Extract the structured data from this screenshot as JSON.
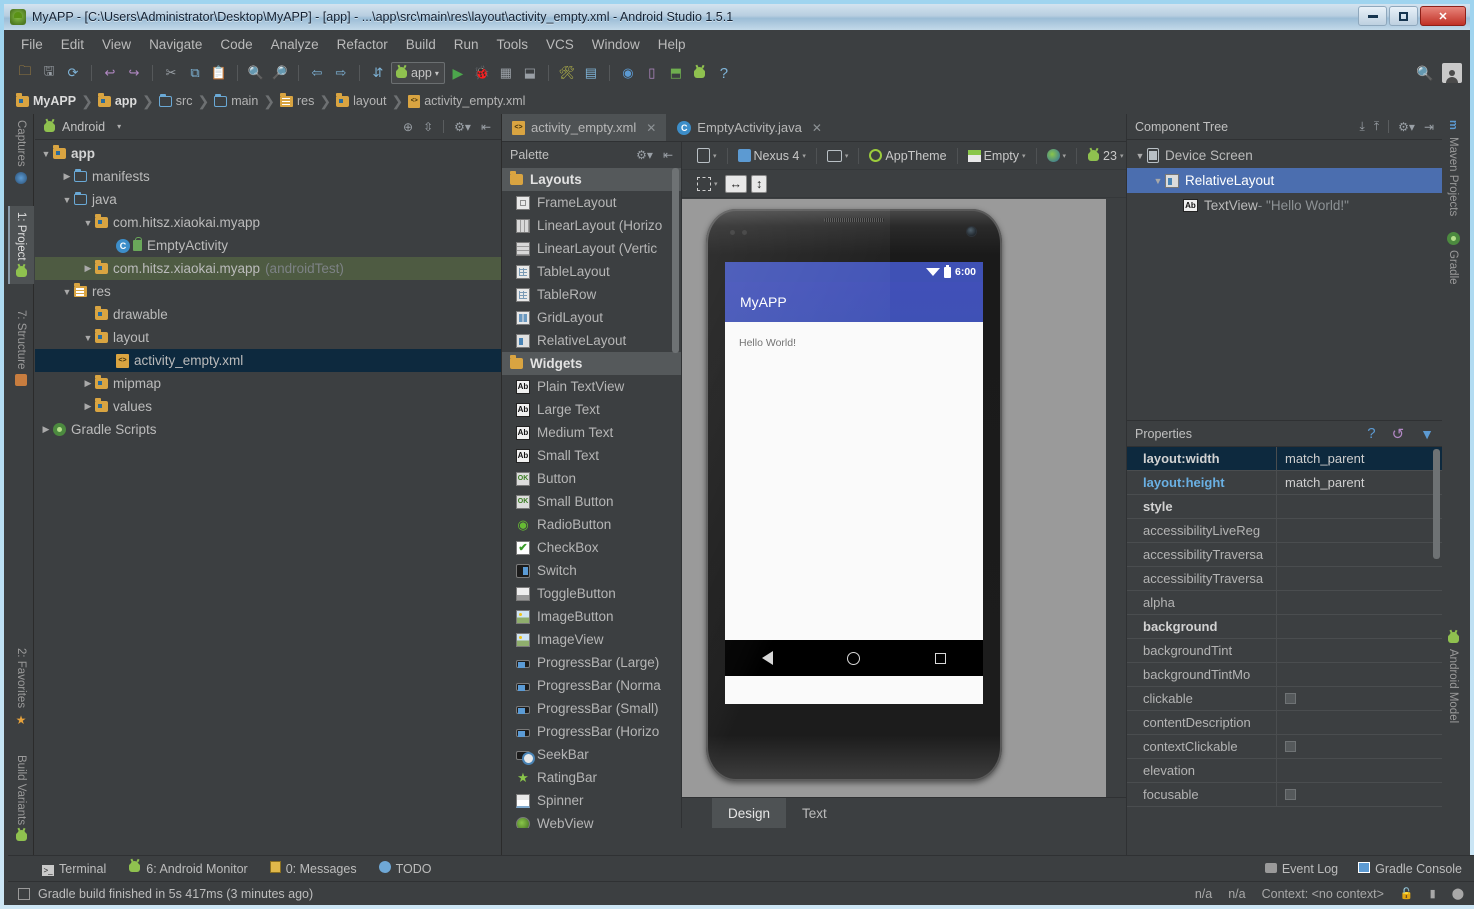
{
  "window": {
    "title": "MyAPP - [C:\\Users\\Administrator\\Desktop\\MyAPP] - [app] - ...\\app\\src\\main\\res\\layout\\activity_empty.xml - Android Studio 1.5.1",
    "minimize": "—",
    "maximize": "▫",
    "close": "✕"
  },
  "menubar": {
    "items": [
      "File",
      "Edit",
      "View",
      "Navigate",
      "Code",
      "Analyze",
      "Refactor",
      "Build",
      "Run",
      "Tools",
      "VCS",
      "Window",
      "Help"
    ]
  },
  "toolbar": {
    "run_config": "app",
    "icons": [
      "open-folder-icon",
      "save-all-icon",
      "sync-icon",
      "undo-icon",
      "redo-icon",
      "cut-icon",
      "copy-icon",
      "paste-icon",
      "find-icon",
      "replace-icon",
      "back-icon",
      "forward-icon",
      "compile-icon",
      "run-icon",
      "debug-icon",
      "coverage-icon",
      "attach-debugger-icon",
      "sdk-manager-icon",
      "avd-manager-icon",
      "layout-inspector-icon",
      "sync-gradle-icon",
      "android-monitor-icon",
      "device-icon",
      "help-icon"
    ],
    "search_icon": "search-icon",
    "avatar_icon": "user-avatar-icon"
  },
  "breadcrumb": {
    "items": [
      "MyAPP",
      "app",
      "src",
      "main",
      "res",
      "layout",
      "activity_empty.xml"
    ]
  },
  "left_strip": {
    "tabs": [
      "Captures",
      "1: Project",
      "7: Structure",
      "2: Favorites",
      "Build Variants"
    ],
    "active": "1: Project"
  },
  "right_strip": {
    "tabs": [
      "Maven Projects",
      "Gradle",
      "Android Model"
    ]
  },
  "project_panel": {
    "header": {
      "label": "Android",
      "caret": "▾"
    },
    "tree": [
      {
        "depth": 0,
        "arrow": "▼",
        "icon": "module-folder",
        "label": "app",
        "bold": true,
        "state": "normal"
      },
      {
        "depth": 1,
        "arrow": "▶",
        "icon": "folder-blue",
        "label": "manifests",
        "bold": false,
        "state": "normal"
      },
      {
        "depth": 1,
        "arrow": "▼",
        "icon": "folder-blue",
        "label": "java",
        "bold": false,
        "state": "normal"
      },
      {
        "depth": 2,
        "arrow": "▼",
        "icon": "package-folder",
        "label": "com.hitsz.xiaokai.myapp",
        "bold": false,
        "state": "normal"
      },
      {
        "depth": 3,
        "arrow": "",
        "icon": "java-class",
        "label": "EmptyActivity",
        "bold": false,
        "state": "normal"
      },
      {
        "depth": 2,
        "arrow": "▶",
        "icon": "package-folder",
        "label": "com.hitsz.xiaokai.myapp",
        "suffix": "(androidTest)",
        "bold": false,
        "state": "test-highlight"
      },
      {
        "depth": 1,
        "arrow": "▼",
        "icon": "res-folder",
        "label": "res",
        "bold": false,
        "state": "normal"
      },
      {
        "depth": 2,
        "arrow": "",
        "icon": "package-folder",
        "label": "drawable",
        "bold": false,
        "state": "normal"
      },
      {
        "depth": 2,
        "arrow": "▼",
        "icon": "package-folder",
        "label": "layout",
        "bold": false,
        "state": "normal"
      },
      {
        "depth": 3,
        "arrow": "",
        "icon": "xml-file",
        "label": "activity_empty.xml",
        "bold": false,
        "state": "selected"
      },
      {
        "depth": 2,
        "arrow": "▶",
        "icon": "package-folder",
        "label": "mipmap",
        "bold": false,
        "state": "normal"
      },
      {
        "depth": 2,
        "arrow": "▶",
        "icon": "package-folder",
        "label": "values",
        "bold": false,
        "state": "normal"
      },
      {
        "depth": 0,
        "arrow": "▶",
        "icon": "gradle",
        "label": "Gradle Scripts",
        "bold": false,
        "state": "normal"
      }
    ]
  },
  "editor": {
    "tabs": [
      {
        "label": "activity_empty.xml",
        "icon": "xml-file-icon",
        "active": true,
        "close": "✕"
      },
      {
        "label": "EmptyActivity.java",
        "icon": "java-class-icon",
        "active": false,
        "close": "✕"
      }
    ]
  },
  "palette": {
    "title": "Palette",
    "groups": [
      {
        "name": "Layouts",
        "items": [
          {
            "label": "FrameLayout",
            "icon": "frame-layout-icon"
          },
          {
            "label": "LinearLayout (Horizo",
            "icon": "linear-horizontal-icon"
          },
          {
            "label": "LinearLayout (Vertic",
            "icon": "linear-vertical-icon"
          },
          {
            "label": "TableLayout",
            "icon": "table-layout-icon"
          },
          {
            "label": "TableRow",
            "icon": "table-row-icon"
          },
          {
            "label": "GridLayout",
            "icon": "grid-layout-icon"
          },
          {
            "label": "RelativeLayout",
            "icon": "relative-layout-icon"
          }
        ]
      },
      {
        "name": "Widgets",
        "items": [
          {
            "label": "Plain TextView",
            "icon": "ab-icon"
          },
          {
            "label": "Large Text",
            "icon": "ab-icon"
          },
          {
            "label": "Medium Text",
            "icon": "ab-icon"
          },
          {
            "label": "Small Text",
            "icon": "ab-icon"
          },
          {
            "label": "Button",
            "icon": "ok-button-icon"
          },
          {
            "label": "Small Button",
            "icon": "ok-button-icon"
          },
          {
            "label": "RadioButton",
            "icon": "radio-button-icon"
          },
          {
            "label": "CheckBox",
            "icon": "checkbox-icon"
          },
          {
            "label": "Switch",
            "icon": "switch-icon"
          },
          {
            "label": "ToggleButton",
            "icon": "toggle-button-icon"
          },
          {
            "label": "ImageButton",
            "icon": "image-button-icon"
          },
          {
            "label": "ImageView",
            "icon": "image-view-icon"
          },
          {
            "label": "ProgressBar (Large)",
            "icon": "progressbar-icon"
          },
          {
            "label": "ProgressBar (Norma",
            "icon": "progressbar-icon"
          },
          {
            "label": "ProgressBar (Small)",
            "icon": "progressbar-icon"
          },
          {
            "label": "ProgressBar (Horizo",
            "icon": "progressbar-icon"
          },
          {
            "label": "SeekBar",
            "icon": "seekbar-icon"
          },
          {
            "label": "RatingBar",
            "icon": "rating-star-icon"
          },
          {
            "label": "Spinner",
            "icon": "spinner-icon"
          },
          {
            "label": "WebView",
            "icon": "webview-icon"
          }
        ]
      }
    ]
  },
  "design_toolbar": {
    "device_btn": "",
    "device": "Nexus 4",
    "orientation": "",
    "theme": "AppTheme",
    "activity": "Empty",
    "locale": "",
    "api": "23",
    "caret": "▾",
    "zoom_buttons": [
      "zoom-fit-icon",
      "zoom-actual-icon",
      "zoom-in-icon",
      "zoom-out-icon",
      "refresh-render-icon",
      "reload-icon",
      "settings-icon"
    ],
    "row2_buttons": [
      "screen-size-icon",
      "width-icon",
      "height-icon"
    ]
  },
  "preview": {
    "app_title": "MyAPP",
    "status_time": "6:00",
    "hello_text": "Hello World!",
    "nav": [
      "back-button",
      "home-button",
      "recents-button"
    ]
  },
  "design_tabs": {
    "tabs": [
      "Design",
      "Text"
    ],
    "active": "Design"
  },
  "component_tree": {
    "title": "Component Tree",
    "nodes": [
      {
        "depth": 0,
        "arrow": "▼",
        "icon": "device-screen-icon",
        "label": "Device Screen",
        "selected": false
      },
      {
        "depth": 1,
        "arrow": "▼",
        "icon": "relative-layout-icon",
        "label": "RelativeLayout",
        "selected": true
      },
      {
        "depth": 2,
        "arrow": "",
        "icon": "ab-icon",
        "label": "TextView",
        "value": " - \"Hello World!\"",
        "selected": false
      }
    ],
    "icons": [
      "expand-all-icon",
      "collapse-all-icon",
      "gear-icon",
      "hide-icon"
    ]
  },
  "properties": {
    "title": "Properties",
    "icons": [
      "help-icon",
      "restore-icon",
      "filter-icon"
    ],
    "rows": [
      {
        "name": "layout:width",
        "value": "match_parent",
        "style": "bold",
        "selected": true,
        "type": "text"
      },
      {
        "name": "layout:height",
        "value": "match_parent",
        "style": "blue",
        "selected": false,
        "type": "text"
      },
      {
        "name": "style",
        "value": "",
        "style": "bold",
        "selected": false,
        "type": "text"
      },
      {
        "name": "accessibilityLiveReg",
        "value": "",
        "style": "normal",
        "selected": false,
        "type": "text"
      },
      {
        "name": "accessibilityTraversa",
        "value": "",
        "style": "normal",
        "selected": false,
        "type": "text"
      },
      {
        "name": "accessibilityTraversa",
        "value": "",
        "style": "normal",
        "selected": false,
        "type": "text"
      },
      {
        "name": "alpha",
        "value": "",
        "style": "normal",
        "selected": false,
        "type": "text"
      },
      {
        "name": "background",
        "value": "",
        "style": "bold",
        "selected": false,
        "type": "text"
      },
      {
        "name": "backgroundTint",
        "value": "",
        "style": "normal",
        "selected": false,
        "type": "text"
      },
      {
        "name": "backgroundTintMo",
        "value": "",
        "style": "normal",
        "selected": false,
        "type": "text"
      },
      {
        "name": "clickable",
        "value": "",
        "style": "normal",
        "selected": false,
        "type": "checkbox"
      },
      {
        "name": "contentDescription",
        "value": "",
        "style": "normal",
        "selected": false,
        "type": "text"
      },
      {
        "name": "contextClickable",
        "value": "",
        "style": "normal",
        "selected": false,
        "type": "checkbox"
      },
      {
        "name": "elevation",
        "value": "",
        "style": "normal",
        "selected": false,
        "type": "text"
      },
      {
        "name": "focusable",
        "value": "",
        "style": "normal",
        "selected": false,
        "type": "checkbox"
      }
    ]
  },
  "status_bar": {
    "left_buttons": [
      {
        "label": "Terminal",
        "icon": "terminal-icon",
        "mnemonic": ""
      },
      {
        "label": "6: Android Monitor",
        "icon": "android-icon",
        "mnemonic": "6"
      },
      {
        "label": "0: Messages",
        "icon": "messages-icon",
        "mnemonic": "0"
      },
      {
        "label": "TODO",
        "icon": "todo-icon",
        "mnemonic": ""
      }
    ],
    "right_buttons": [
      {
        "label": "Event Log",
        "icon": "event-log-icon"
      },
      {
        "label": "Gradle Console",
        "icon": "gradle-console-icon"
      }
    ]
  },
  "bottom_bar": {
    "message": "Gradle build finished in 5s 417ms (3 minutes ago)",
    "icon": "build-icon",
    "position_1": "n/a",
    "position_2": "n/a",
    "context": "Context: <no context>",
    "right_icons": [
      "lock-icon",
      "memory-icon",
      "notification-icon"
    ]
  },
  "colors": {
    "accent_blue": "#4b6eaf",
    "selection_navy": "#0d293e",
    "panel_bg": "#3c3f41",
    "android_green": "#8fc14f",
    "material_indigo": "#3f51b5"
  }
}
